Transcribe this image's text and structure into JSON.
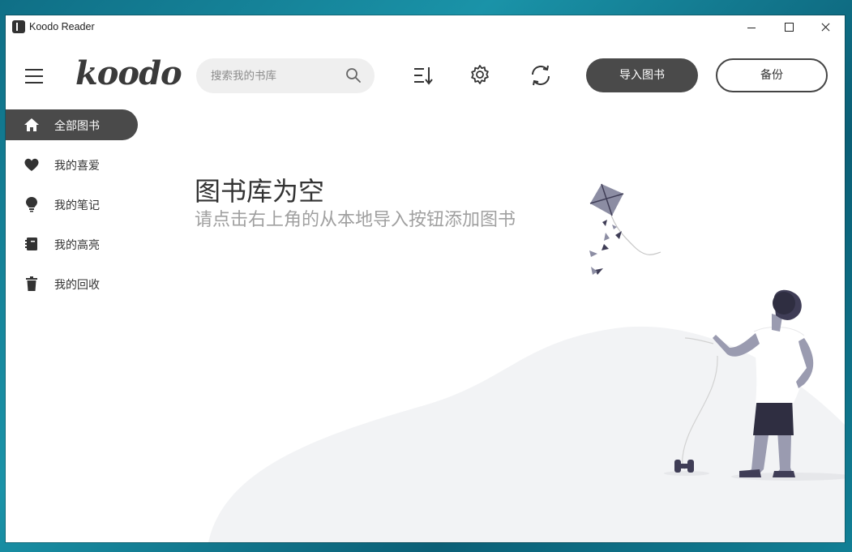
{
  "window": {
    "title": "Koodo Reader"
  },
  "header": {
    "logo": "koodo",
    "search": {
      "placeholder": "搜索我的书库",
      "value": ""
    },
    "import_label": "导入图书",
    "backup_label": "备份"
  },
  "sidebar": {
    "items": [
      {
        "label": "全部图书",
        "icon": "home-icon",
        "active": true
      },
      {
        "label": "我的喜爱",
        "icon": "heart-icon",
        "active": false
      },
      {
        "label": "我的笔记",
        "icon": "lightbulb-icon",
        "active": false
      },
      {
        "label": "我的高亮",
        "icon": "notebook-icon",
        "active": false
      },
      {
        "label": "我的回收",
        "icon": "trash-icon",
        "active": false
      }
    ]
  },
  "empty": {
    "title": "图书库为空",
    "description": "请点击右上角的从本地导入按钮添加图书"
  },
  "colors": {
    "accent": "#4a4a4a",
    "background": "#ffffff",
    "muted_text": "#a0a0a0"
  }
}
